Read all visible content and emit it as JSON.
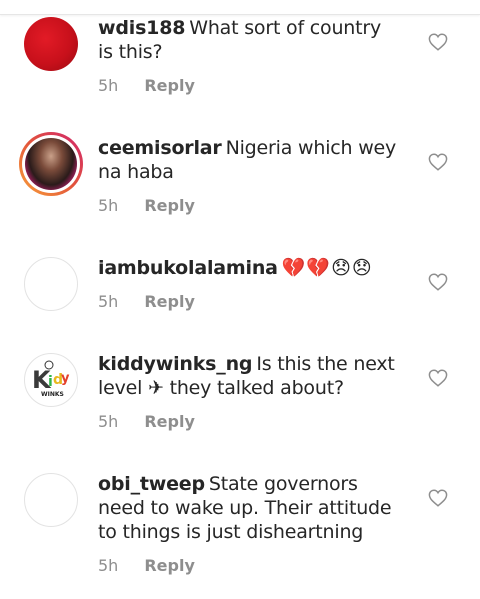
{
  "comments": [
    {
      "username": "wdis188",
      "text": "What sort of country is this?",
      "time": "5h",
      "reply": "Reply",
      "avatar_icon": "red-avatar"
    },
    {
      "username": "ceemisorlar",
      "text": "Nigeria which wey na haba",
      "time": "5h",
      "reply": "Reply",
      "avatar_icon": "story-ring-avatar"
    },
    {
      "username": "iambukolalamina",
      "text": "💔💔😞😞",
      "time": "5h",
      "reply": "Reply",
      "avatar_icon": "empty-avatar"
    },
    {
      "username": "kiddywinks_ng",
      "text": "Is this the next level ✈ they talked about?",
      "time": "5h",
      "reply": "Reply",
      "avatar_icon": "kiddy-winks-logo",
      "logo_text": "KIDDY WINKS"
    },
    {
      "username": "obi_tweep",
      "text": "State governors need to wake up. Their attitude to things is just disheartning",
      "time": "5h",
      "reply": "Reply",
      "avatar_icon": "empty-avatar"
    }
  ],
  "colors": {
    "text": "#262626",
    "meta": "#8e8e8e",
    "heart_outline": "#8e8e8e",
    "story_ring_start": "#f9a23a",
    "story_ring_end": "#d0246e"
  }
}
